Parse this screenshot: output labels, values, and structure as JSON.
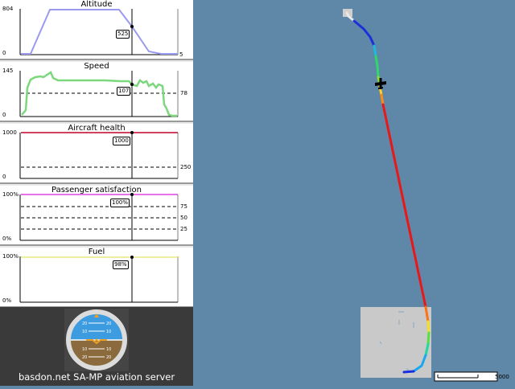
{
  "panels": [
    {
      "title": "Altitude",
      "ymax": "804",
      "ymin": "0",
      "value": "525",
      "ref_label": "5"
    },
    {
      "title": "Speed",
      "ymax": "145",
      "ymin": "0",
      "value": "107",
      "ref_label": "78"
    },
    {
      "title": "Aircraft health",
      "ymax": "1000",
      "ymin": "0",
      "value": "1000",
      "ref_label": "250"
    },
    {
      "title": "Passenger satisfaction",
      "ymax": "100%",
      "ymin": "0%",
      "value": "100%",
      "ref_labels": [
        "75",
        "50",
        "25"
      ]
    },
    {
      "title": "Fuel",
      "ymax": "100%",
      "ymin": "0%",
      "value": "98%"
    }
  ],
  "footer": {
    "text": "basdon.net SA-MP aviation server"
  },
  "map": {
    "scale_label": "5000"
  },
  "colors": {
    "altitude": "#9a9af0",
    "speed": "#7cd87c",
    "health": "#c0002a",
    "satisfaction": "#e040e0",
    "fuel": "#e8e880",
    "map_bg": "#5f87a8"
  },
  "icons": {
    "aircraft": "airplane-icon",
    "horizon": "attitude-indicator-icon"
  }
}
